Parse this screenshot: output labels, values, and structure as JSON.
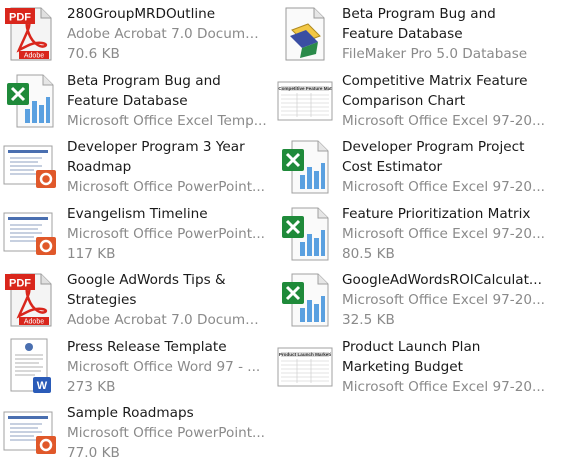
{
  "files": [
    {
      "name_lines": [
        "280GroupMRDOutline"
      ],
      "type": "Adobe Acrobat 7.0 Document",
      "size": "70.6 KB",
      "icon": "pdf-icon",
      "col": 1,
      "row": 1
    },
    {
      "name_lines": [
        "Beta Program Bug and",
        "Feature Database"
      ],
      "type": "FileMaker Pro 5.0 Database",
      "size": "",
      "icon": "filemaker-icon",
      "col": 2,
      "row": 1
    },
    {
      "name_lines": [
        "Beta Program Bug and",
        "Feature Database"
      ],
      "type": "Microsoft Office Excel Temp...",
      "size": "",
      "icon": "excel-icon",
      "col": 1,
      "row": 2
    },
    {
      "name_lines": [
        "Competitive Matrix Feature",
        "Comparison Chart"
      ],
      "type": "Microsoft Office Excel 97-20...",
      "size": "",
      "icon": "excel-thumbnail-icon",
      "col": 2,
      "row": 2
    },
    {
      "name_lines": [
        "Developer Program 3 Year",
        "Roadmap"
      ],
      "type": "Microsoft Office PowerPoint...",
      "size": "",
      "icon": "powerpoint-icon",
      "col": 1,
      "row": 3
    },
    {
      "name_lines": [
        "Developer Program Project",
        "Cost Estimator"
      ],
      "type": "Microsoft Office Excel 97-20...",
      "size": "",
      "icon": "excel-icon",
      "col": 2,
      "row": 3
    },
    {
      "name_lines": [
        "Evangelism Timeline"
      ],
      "type": "Microsoft Office PowerPoint...",
      "size": "117 KB",
      "icon": "powerpoint-icon",
      "col": 1,
      "row": 4
    },
    {
      "name_lines": [
        "Feature Prioritization Matrix"
      ],
      "type": "Microsoft Office Excel 97-20...",
      "size": "80.5 KB",
      "icon": "excel-icon",
      "col": 2,
      "row": 4
    },
    {
      "name_lines": [
        "Google AdWords Tips &",
        "Strategies"
      ],
      "type": "Adobe Acrobat 7.0 Document",
      "size": "",
      "icon": "pdf-icon",
      "col": 1,
      "row": 5
    },
    {
      "name_lines": [
        "GoogleAdWordsROICalculat..."
      ],
      "type": "Microsoft Office Excel 97-20...",
      "size": "32.5 KB",
      "icon": "excel-icon",
      "col": 2,
      "row": 5
    },
    {
      "name_lines": [
        "Press Release Template"
      ],
      "type": "Microsoft Office Word 97 - ...",
      "size": "273 KB",
      "icon": "word-icon",
      "col": 1,
      "row": 6
    },
    {
      "name_lines": [
        "Product Launch Plan",
        "Marketing Budget"
      ],
      "type": "Microsoft Office Excel 97-20...",
      "size": "",
      "icon": "excel-thumbnail-icon",
      "col": 2,
      "row": 6
    },
    {
      "name_lines": [
        "Sample Roadmaps"
      ],
      "type": "Microsoft Office PowerPoint...",
      "size": "77.0 KB",
      "icon": "powerpoint-icon",
      "col": 1,
      "row": 7
    }
  ],
  "thumbnails": {
    "competitive_title": "Competitive Feature Mat",
    "launch_title": "Product Launch Marketi"
  },
  "colors": {
    "pdf_red": "#d9261c",
    "excel_green": "#1f8a3a",
    "ppt_orange": "#e0582a",
    "word_blue": "#2a5bb8",
    "filemaker_blue": "#3a4ea3",
    "secondary_text": "#8a8a8a"
  }
}
